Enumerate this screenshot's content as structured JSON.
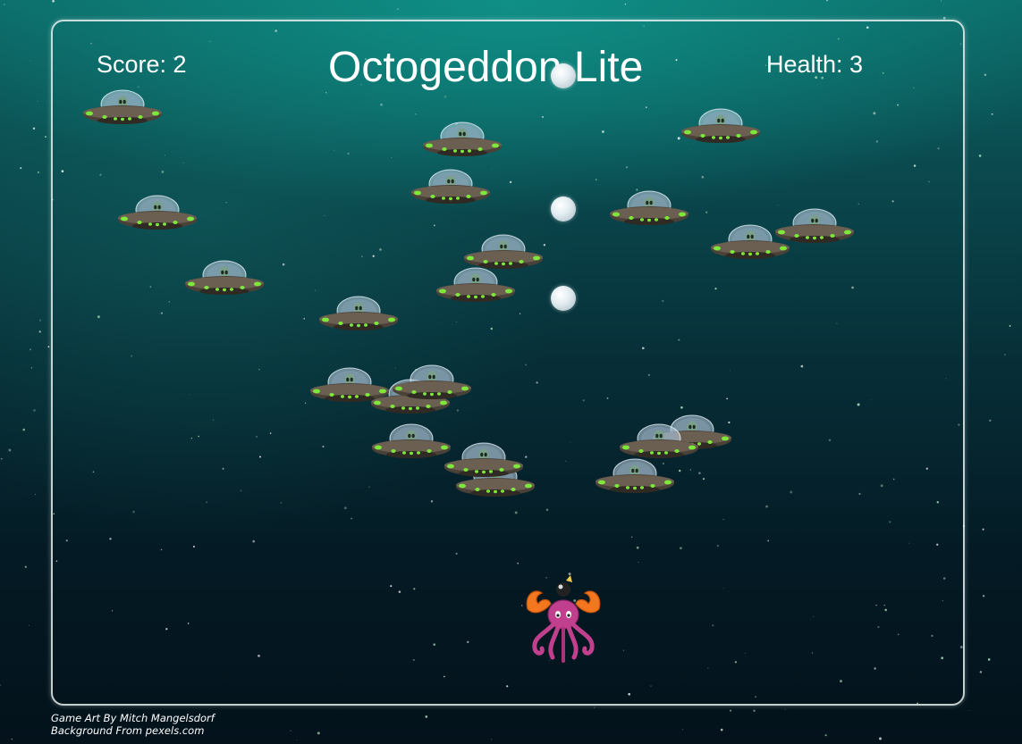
{
  "hud": {
    "score_label": "Score: 2",
    "title": "Octogeddon Lite",
    "health_label": "Health: 3"
  },
  "credits": {
    "art": "Game Art By Mitch Mangelsdorf",
    "background": "Background From pexels.com"
  },
  "colors": {
    "text": "#ffffff",
    "ufo_lights": "#7ee83a",
    "octopus": "#c0408e",
    "crab_claw": "#f2771f"
  },
  "icons": {
    "enemy": "ufo-icon",
    "projectile": "bubble-icon",
    "player": "octopus-icon"
  }
}
